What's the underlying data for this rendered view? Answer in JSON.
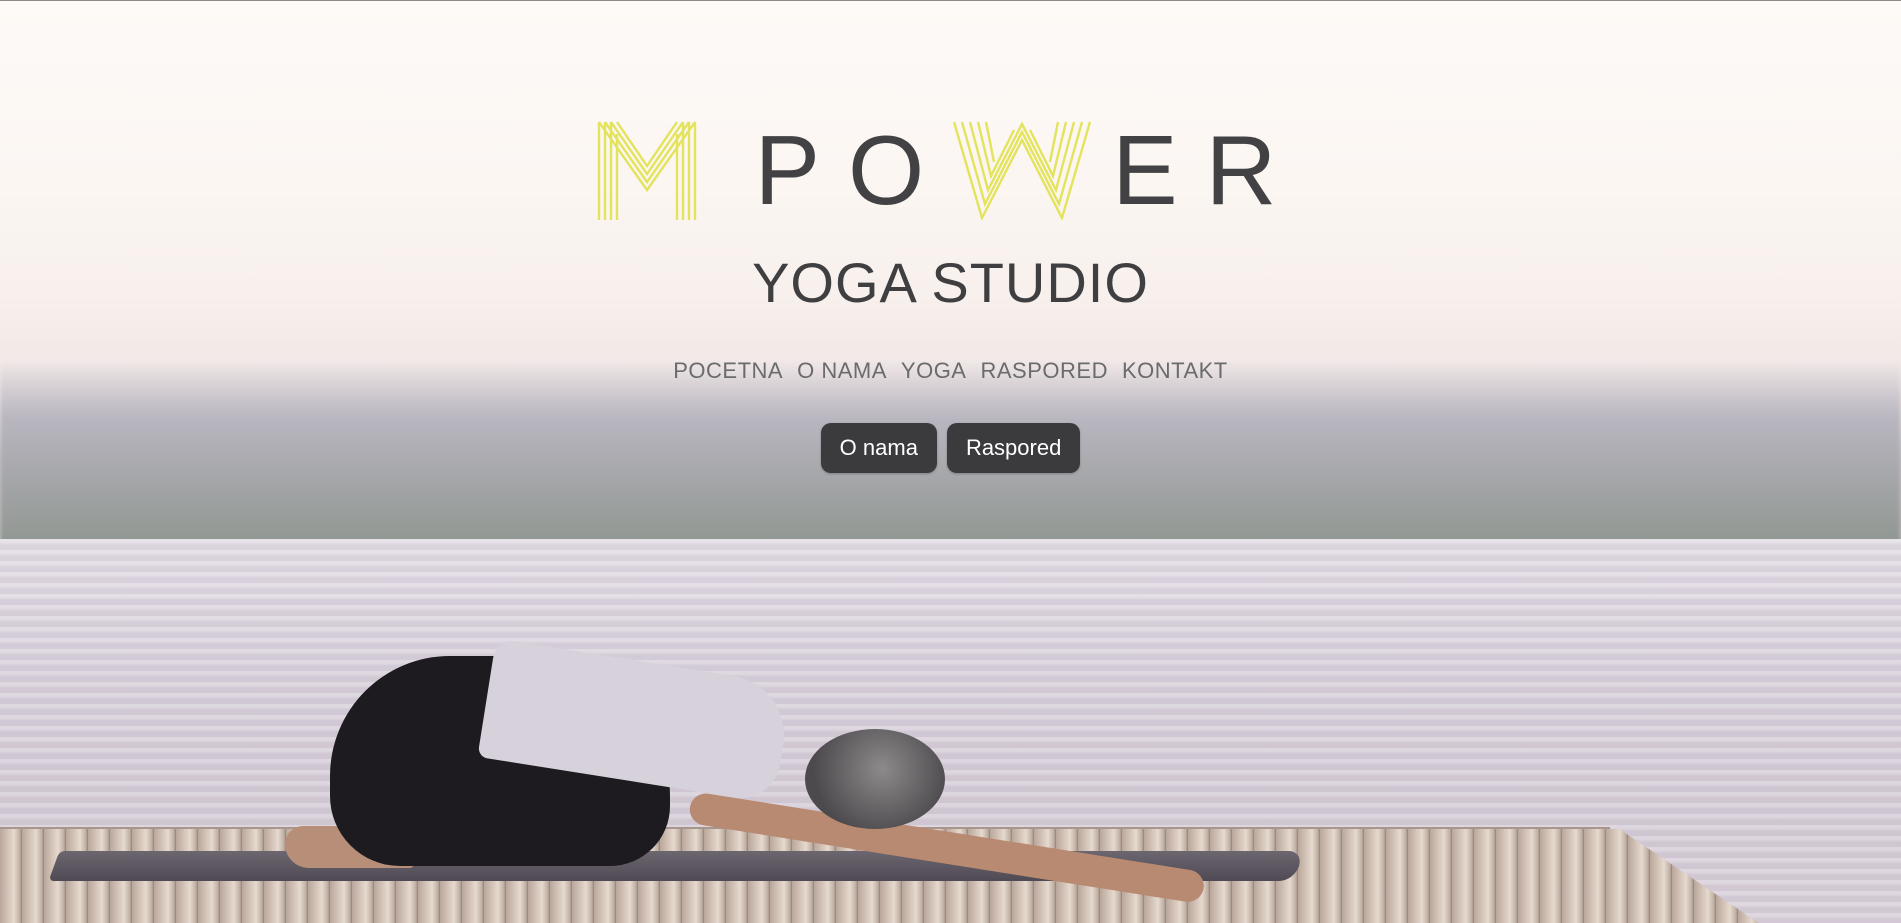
{
  "brand": {
    "logo_accent_m": "M",
    "logo_word_po": "PO",
    "logo_accent_w": "W",
    "logo_word_er": "ER",
    "subtitle": "YOGA STUDIO",
    "accent_color": "#e3e35c",
    "text_color": "#424244"
  },
  "nav": {
    "items": [
      {
        "label": "POCETNA"
      },
      {
        "label": "O NAMA"
      },
      {
        "label": "YOGA"
      },
      {
        "label": "RASPORED"
      },
      {
        "label": "KONTAKT"
      }
    ]
  },
  "cta": {
    "primary_label": "O nama",
    "secondary_label": "Raspored"
  },
  "hero": {
    "image_description_icon": "yoga-child-pose-photo"
  }
}
